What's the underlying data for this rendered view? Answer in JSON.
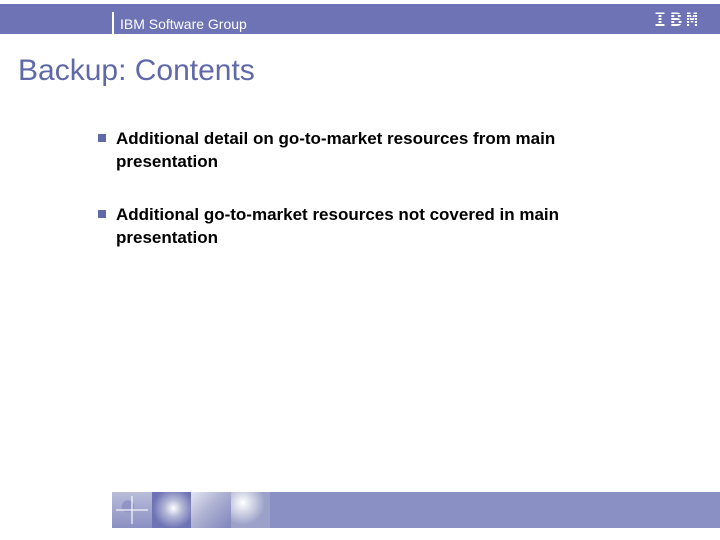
{
  "header": {
    "group_label": "IBM Software Group",
    "logo_text": "IBM"
  },
  "title": "Backup: Contents",
  "bullets": [
    "Additional detail on go-to-market resources from main presentation",
    "Additional go-to-market resources not covered in main presentation"
  ]
}
